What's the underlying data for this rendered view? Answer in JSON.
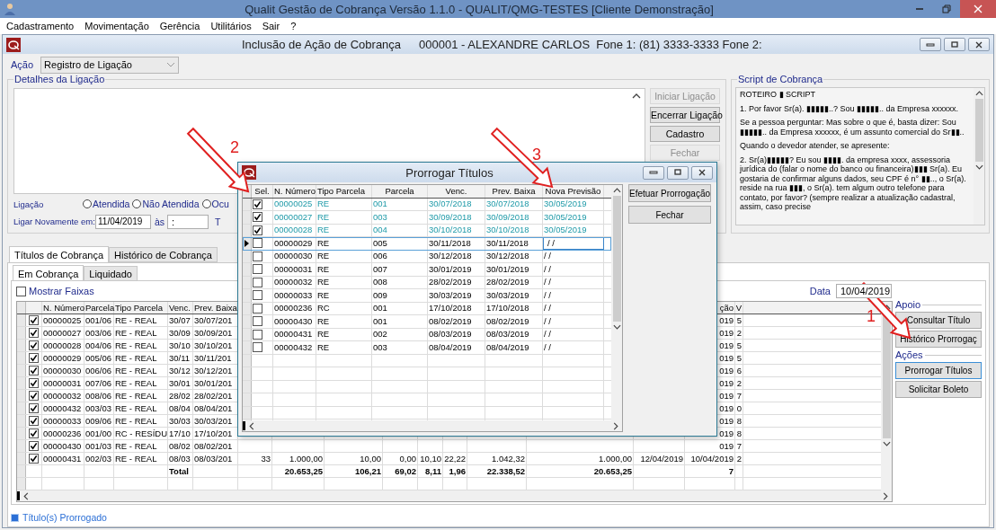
{
  "window": {
    "title": "Qualit Gestão de Cobrança Versão 1.1.0 - QUALIT/QMG-TESTES [Cliente Demonstração]"
  },
  "menu": [
    "Cadastramento",
    "Movimentação",
    "Gerência",
    "Utilitários",
    "Sair",
    "?"
  ],
  "form": {
    "title": "Inclusão de Ação de Cobrança",
    "client": "000001 - ALEXANDRE CARLOS  Fone 1: (81) 3333-3333 Fone 2:"
  },
  "acao": {
    "label": "Ação",
    "value": "Registro de Ligação"
  },
  "detalhes": {
    "legend": "Detalhes da Ligação",
    "buttons": [
      {
        "label": "Iniciar Ligação",
        "disabled": true
      },
      {
        "label": "Encerrar Ligação",
        "disabled": false
      },
      {
        "label": "Cadastro",
        "disabled": false
      },
      {
        "label": "Fechar",
        "disabled": true
      }
    ]
  },
  "ligacao": {
    "label": "Ligação",
    "options": [
      {
        "label": "Atendida",
        "selected": false
      },
      {
        "label": "Não Atendida",
        "selected": false
      },
      {
        "label": "Ocu",
        "selected": false
      }
    ]
  },
  "ligar_novamente": {
    "label": "Ligar Novamente em:",
    "date": "11/04/2019",
    "at_label": "às",
    "time": ":",
    "label_3": "T"
  },
  "script": {
    "legend": "Script de Cobrança",
    "paragraphs": [
      "ROTEIRO ▮ SCRIPT",
      "1. Por favor Sr(a). ▮▮▮▮▮..? Sou ▮▮▮▮▮.. da Empresa xxxxxx.",
      "Se a pessoa perguntar: Mas sobre o que é, basta dizer: Sou ▮▮▮▮▮.. da Empresa xxxxxx, é um assunto comercial do Sr▮▮..",
      "Quando o devedor atender, se apresente:",
      "2. Sr(a)▮▮▮▮▮? Eu sou ▮▮▮▮. da empresa xxxx, assessoria jurídica do (falar o nome do banco ou financeira)▮▮▮ Sr(a). Eu gostaria de confirmar alguns dados, seu CPF é n° ▮▮.., o Sr(a). reside na rua ▮▮▮, o Sr(a). tem algum outro telefone para contato, por favor? (sempre realizar a atualização cadastral, assim, caso precise"
    ]
  },
  "tabs": [
    {
      "label": "Títulos de Cobrança",
      "selected": true
    },
    {
      "label": "Histórico de Cobrança",
      "selected": false
    }
  ],
  "subtabs": [
    {
      "label": "Em Cobrança",
      "selected": true
    },
    {
      "label": "Liquidado",
      "selected": false
    }
  ],
  "mostrar_faixas": {
    "label": "Mostrar Faixas",
    "checked": false
  },
  "data": {
    "label": "Data",
    "value": "10/04/2019"
  },
  "table": {
    "headings": {
      "column_1": "N. Número",
      "column_2": "Parcela",
      "column_3": "Tipo Parcela",
      "column_4": "Venc.",
      "column_5": "Prev. Baixa",
      "column_15": "ção",
      "column_16": "V"
    },
    "rows": [
      {
        "checked": true,
        "cells": {
          "column_1": "00000025",
          "column_2": "001/06",
          "column_3": "RE - REAL",
          "column_4": "30/07",
          "column_5": "30/07/201",
          "column_15": "019",
          "column_16": "5"
        }
      },
      {
        "checked": true,
        "cells": {
          "column_1": "00000027",
          "column_2": "003/06",
          "column_3": "RE - REAL",
          "column_4": "30/09",
          "column_5": "30/09/201",
          "column_15": "019",
          "column_16": "2"
        }
      },
      {
        "checked": true,
        "cells": {
          "column_1": "00000028",
          "column_2": "004/06",
          "column_3": "RE - REAL",
          "column_4": "30/10",
          "column_5": "30/10/201",
          "column_15": "019",
          "column_16": "5"
        }
      },
      {
        "checked": true,
        "cells": {
          "column_1": "00000029",
          "column_2": "005/06",
          "column_3": "RE - REAL",
          "column_4": "30/11",
          "column_5": "30/11/201",
          "column_15": "019",
          "column_16": "5"
        }
      },
      {
        "checked": true,
        "cells": {
          "column_1": "00000030",
          "column_2": "006/06",
          "column_3": "RE - REAL",
          "column_4": "30/12",
          "column_5": "30/12/201",
          "column_15": "019",
          "column_16": "6"
        }
      },
      {
        "checked": true,
        "cells": {
          "column_1": "00000031",
          "column_2": "007/06",
          "column_3": "RE - REAL",
          "column_4": "30/01",
          "column_5": "30/01/201",
          "column_15": "019",
          "column_16": "2"
        }
      },
      {
        "checked": true,
        "cells": {
          "column_1": "00000032",
          "column_2": "008/06",
          "column_3": "RE - REAL",
          "column_4": "28/02",
          "column_5": "28/02/201",
          "column_15": "019",
          "column_16": "7"
        }
      },
      {
        "checked": true,
        "cells": {
          "column_1": "00000432",
          "column_2": "003/03",
          "column_3": "RE - REAL",
          "column_4": "08/04",
          "column_5": "08/04/201",
          "column_15": "019",
          "column_16": "0"
        }
      },
      {
        "checked": true,
        "cells": {
          "column_1": "00000033",
          "column_2": "009/06",
          "column_3": "RE - REAL",
          "column_4": "30/03",
          "column_5": "30/03/201",
          "column_15": "019",
          "column_16": "8"
        }
      },
      {
        "checked": true,
        "cells": {
          "column_1": "00000236",
          "column_2": "001/00",
          "column_3": "RC - RESÍDU",
          "column_4": "17/10",
          "column_5": "17/10/201",
          "column_15": "019",
          "column_16": "8"
        }
      },
      {
        "checked": true,
        "cells": {
          "column_1": "00000430",
          "column_2": "001/03",
          "column_3": "RE - REAL",
          "column_4": "08/02",
          "column_5": "08/02/201",
          "column_15": "019",
          "column_16": "7"
        }
      },
      {
        "checked": true,
        "cells": {
          "column_1": "00000431",
          "column_2": "002/03",
          "column_3": "RE - REAL",
          "column_4": "08/03",
          "column_5": "08/03/201",
          "column_6": "33",
          "column_7": "1.000,00",
          "column_8": "10,00",
          "column_9": "0,00",
          "column_10": "10,10",
          "column_11": "22,22",
          "column_12": "1.042,32",
          "column_13": "1.000,00",
          "column_14": "12/04/2019",
          "column_15": "10/04/2019",
          "column_16": "2"
        }
      }
    ],
    "total": {
      "column_4": "Total",
      "column_7": "20.653,25",
      "column_8": "106,21",
      "column_9": "69,02",
      "column_10": "8,11",
      "column_11": "1,96",
      "column_12": "22.338,52",
      "column_13": "20.653,25",
      "column_15": "7"
    }
  },
  "apoio": {
    "legend": "Apoio",
    "buttons": [
      "Consultar Título",
      "Histórico Prorrogaç"
    ]
  },
  "acoes": {
    "legend": "Ações",
    "buttons": [
      "Prorrogar Títulos",
      "Solicitar Boleto"
    ]
  },
  "legend_note": "Título(s) Prorrogado",
  "dialog": {
    "title": "Prorrogar Títulos",
    "columns": [
      "Sel.",
      "N. Número",
      "Tipo Parcela",
      "Parcela",
      "Venc.",
      "Prev. Baixa",
      "Nova Previsão"
    ],
    "rows": [
      {
        "checked": true,
        "current": false,
        "n_numero": "00000025",
        "tipo": "RE",
        "parcela": "001",
        "venc": "30/07/2018",
        "prev_baixa": "30/07/2018",
        "nova": "30/05/2019"
      },
      {
        "checked": true,
        "current": false,
        "n_numero": "00000027",
        "tipo": "RE",
        "parcela": "003",
        "venc": "30/09/2018",
        "prev_baixa": "30/09/2018",
        "nova": "30/05/2019"
      },
      {
        "checked": true,
        "current": false,
        "n_numero": "00000028",
        "tipo": "RE",
        "parcela": "004",
        "venc": "30/10/2018",
        "prev_baixa": "30/10/2018",
        "nova": "30/05/2019"
      },
      {
        "checked": false,
        "current": true,
        "n_numero": "00000029",
        "tipo": "RE",
        "parcela": "005",
        "venc": "30/11/2018",
        "prev_baixa": "30/11/2018",
        "nova": "/ /"
      },
      {
        "checked": false,
        "current": false,
        "n_numero": "00000030",
        "tipo": "RE",
        "parcela": "006",
        "venc": "30/12/2018",
        "prev_baixa": "30/12/2018",
        "nova": "/ /"
      },
      {
        "checked": false,
        "current": false,
        "n_numero": "00000031",
        "tipo": "RE",
        "parcela": "007",
        "venc": "30/01/2019",
        "prev_baixa": "30/01/2019",
        "nova": "/ /"
      },
      {
        "checked": false,
        "current": false,
        "n_numero": "00000032",
        "tipo": "RE",
        "parcela": "008",
        "venc": "28/02/2019",
        "prev_baixa": "28/02/2019",
        "nova": "/ /"
      },
      {
        "checked": false,
        "current": false,
        "n_numero": "00000033",
        "tipo": "RE",
        "parcela": "009",
        "venc": "30/03/2019",
        "prev_baixa": "30/03/2019",
        "nova": "/ /"
      },
      {
        "checked": false,
        "current": false,
        "n_numero": "00000236",
        "tipo": "RC",
        "parcela": "001",
        "venc": "17/10/2018",
        "prev_baixa": "17/10/2018",
        "nova": "/ /"
      },
      {
        "checked": false,
        "current": false,
        "n_numero": "00000430",
        "tipo": "RE",
        "parcela": "001",
        "venc": "08/02/2019",
        "prev_baixa": "08/02/2019",
        "nova": "/ /"
      },
      {
        "checked": false,
        "current": false,
        "n_numero": "00000431",
        "tipo": "RE",
        "parcela": "002",
        "venc": "08/03/2019",
        "prev_baixa": "08/03/2019",
        "nova": "/ /"
      },
      {
        "checked": false,
        "current": false,
        "n_numero": "00000432",
        "tipo": "RE",
        "parcela": "003",
        "venc": "08/04/2019",
        "prev_baixa": "08/04/2019",
        "nova": "/ /"
      }
    ],
    "buttons": [
      "Efetuar Prorrogação",
      "Fechar"
    ]
  },
  "annotations": [
    {
      "label": "1"
    },
    {
      "label": "2"
    },
    {
      "label": "3"
    }
  ]
}
